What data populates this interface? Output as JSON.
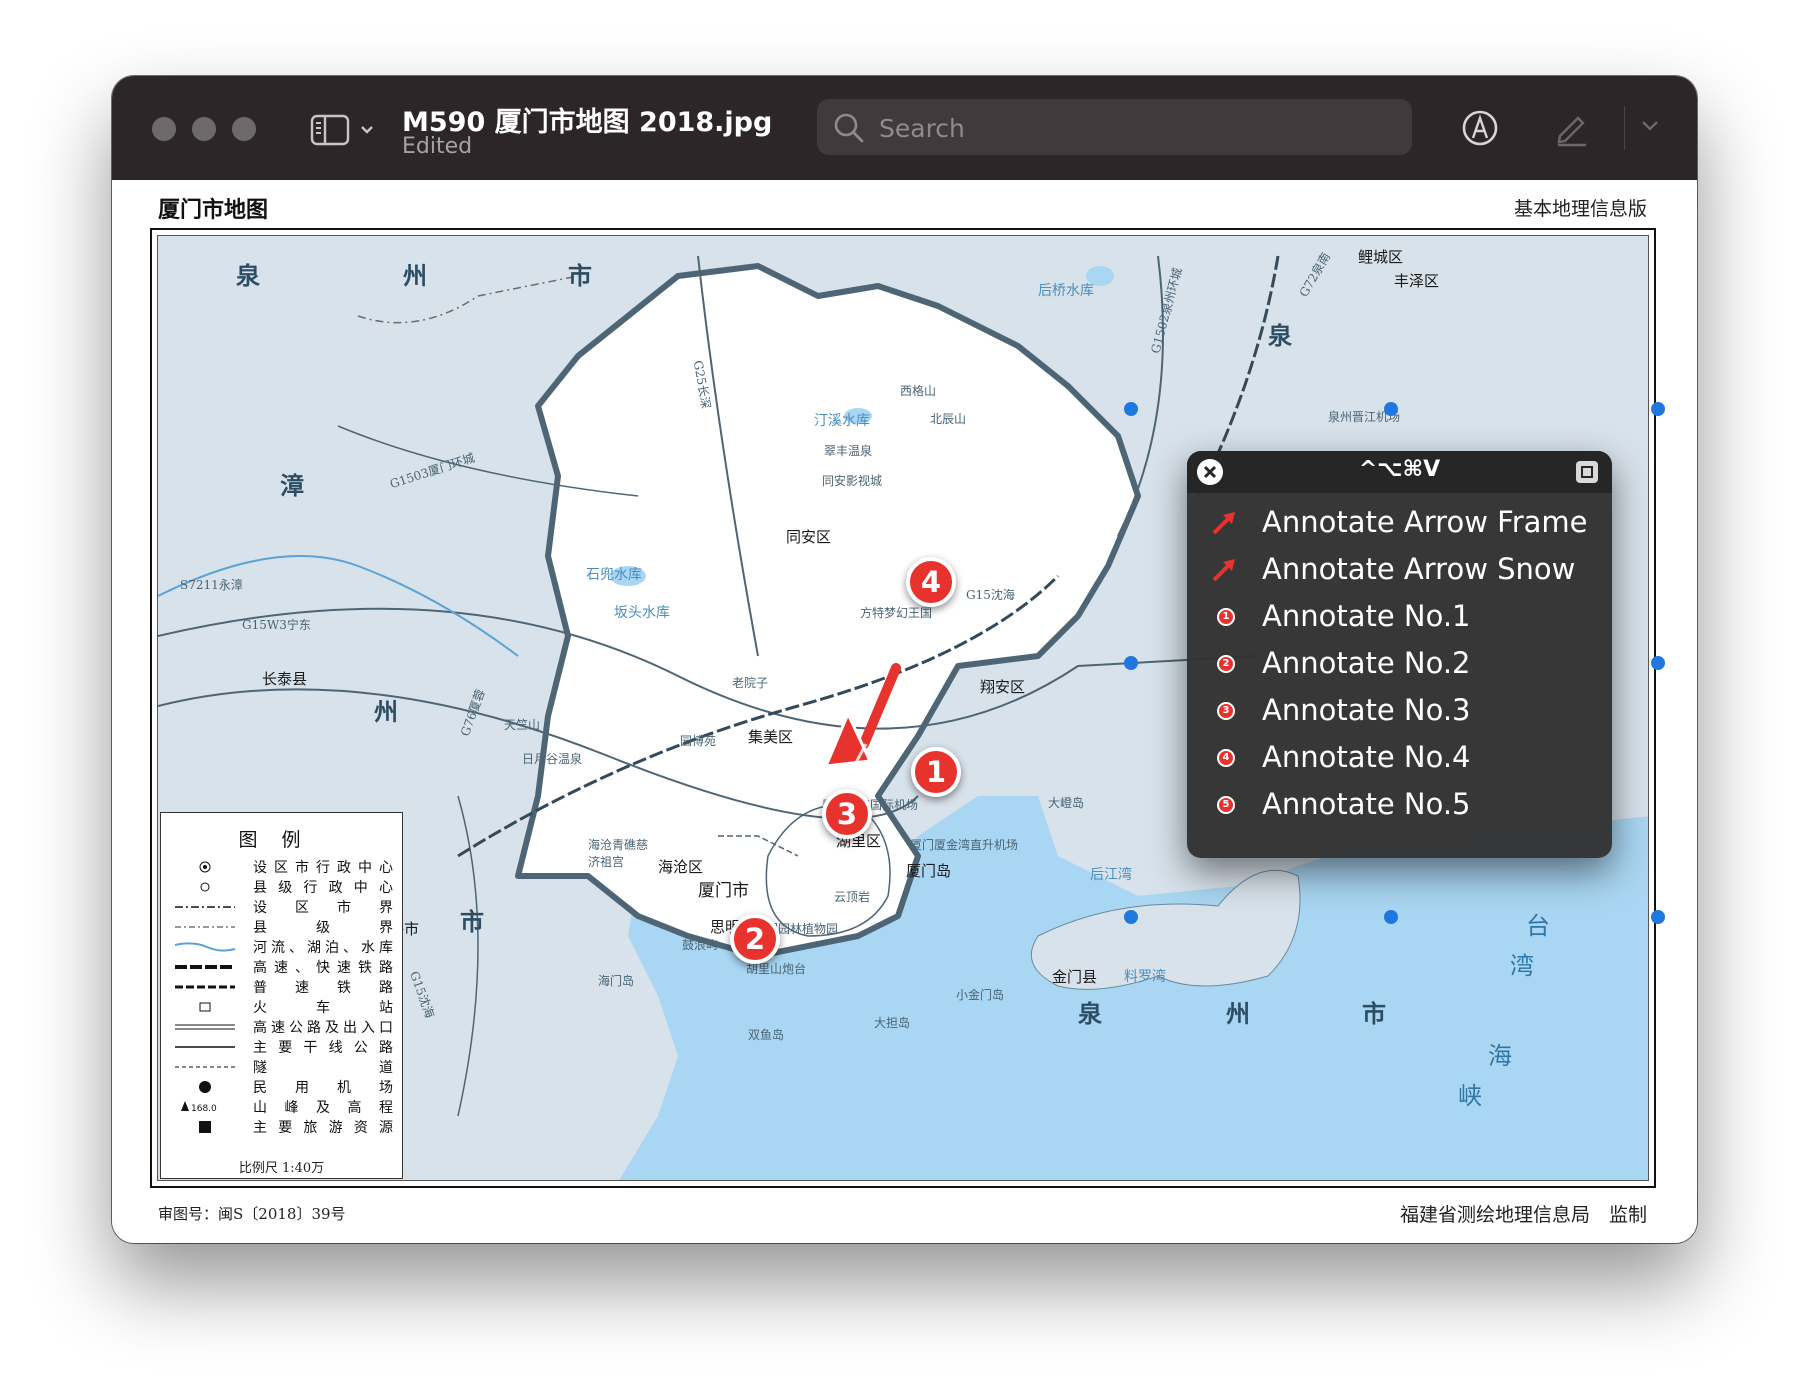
{
  "window": {
    "title": "M590 厦门市地图 2018.jpg",
    "subtitle": "Edited",
    "search_placeholder": "Search"
  },
  "colors": {
    "titlebar": "#2d2629",
    "sea": "#a9d6f2",
    "land": "#d8e2ea",
    "xiamen_land": "#ffffff",
    "accent_red": "#e8322d",
    "handle_blue": "#1f78e0"
  },
  "icons": [
    "sidebar-icon",
    "chevron-down-icon",
    "search-icon",
    "markup-icon",
    "pen-icon",
    "close-icon",
    "command-icon",
    "arrow-icon"
  ],
  "map": {
    "title": "厦门市地图",
    "edition": "基本地理信息版",
    "footer_left": "审图号：闽S〔2018〕39号",
    "footer_right": "福建省测绘地理信息局　监制",
    "regions": {
      "quanzhou_top_1": "泉",
      "quanzhou_top_2": "州",
      "quanzhou_top_3": "市",
      "zhang": "漳",
      "zhou_left": "州",
      "shi_left": "市",
      "quan_right": "泉",
      "quan_bottom": "泉",
      "zhou_bottom": "州",
      "shi_bottom": "市",
      "tai": "台",
      "wan": "湾",
      "hai": "海",
      "xia": "峡"
    },
    "places": {
      "tongan": "同安区",
      "jimei": "集美区",
      "haicang": "海沧区",
      "xiamen": "厦门市",
      "huli": "湖里区",
      "siming": "思明区",
      "xiangan": "翔安区",
      "changtai": "长泰县",
      "longhai": "龙海市",
      "jinmen": "金门县",
      "licheng": "鲤城区",
      "fengze": "丰泽区",
      "xiamen_island": "厦门岛",
      "dadeng": "大嶝岛",
      "xiaojinmen": "小金门岛",
      "gulangyu": "鼓浪屿",
      "haimen": "海门岛",
      "xiamen_airport": "厦门高崎国际机场",
      "xiangan_airport": "厦门厦金湾直升机场",
      "quanzhou_airport": "泉州晋江机场",
      "fangte": "方特梦幻王国",
      "yuanboyuan": "园博苑",
      "haicang_temple": "海沧青礁慈济祖宫",
      "cuifeng": "翠丰温泉",
      "tongan_film": "同安影视城",
      "rirong": "日月谷温泉",
      "tianzhu": "天竺山",
      "beichen": "北辰山",
      "xige": "西格山",
      "yunding": "云顶岩",
      "huli_fort": "胡里山炮台",
      "botanical": "厦门园林植物园",
      "laoyuanzi": "老院子",
      "houqiao": "后桥水库",
      "tingxi": "汀溪水库",
      "shidou": "石兜水库",
      "bankeng": "坂头水库",
      "houjiang": "后江湾",
      "liaoluo": "料罗湾",
      "shuangyu": "双鱼岛",
      "dadan": "大担岛"
    },
    "highways": {
      "g1503": "G1503厦门环城",
      "s7211": "S7211永漳",
      "g15w3": "G15W3宁东",
      "g76": "G76厦蓉",
      "g15_bottom": "G15沈海",
      "g15_top": "G15沈海",
      "g25": "G25长深",
      "g1502": "G1502泉州环城",
      "g72": "G72泉南"
    },
    "legend": {
      "title": "图例",
      "items": [
        "设区市行政中心",
        "县级行政中心",
        "设区市界",
        "县级界",
        "河流、湖泊、水库",
        "高速、快速铁路",
        "普速铁路",
        "火车站",
        "高速公路及出入口",
        "主要干线公路",
        "隧道",
        "民用机场",
        "山峰及高程",
        "主要旅游资源"
      ],
      "peak_height": "168.0",
      "scale": "比例尺 1:40万"
    },
    "badges": [
      "1",
      "2",
      "3",
      "4"
    ]
  },
  "popup": {
    "shortcut": "^⌥⌘V",
    "items": [
      {
        "label": "Annotate Arrow Frame",
        "icon": "arrow-icon"
      },
      {
        "label": "Annotate Arrow Snow",
        "icon": "arrow-icon"
      },
      {
        "label": "Annotate No.1",
        "num": "1"
      },
      {
        "label": "Annotate No.2",
        "num": "2"
      },
      {
        "label": "Annotate No.3",
        "num": "3"
      },
      {
        "label": "Annotate No.4",
        "num": "4"
      },
      {
        "label": "Annotate No.5",
        "num": "5"
      }
    ]
  }
}
